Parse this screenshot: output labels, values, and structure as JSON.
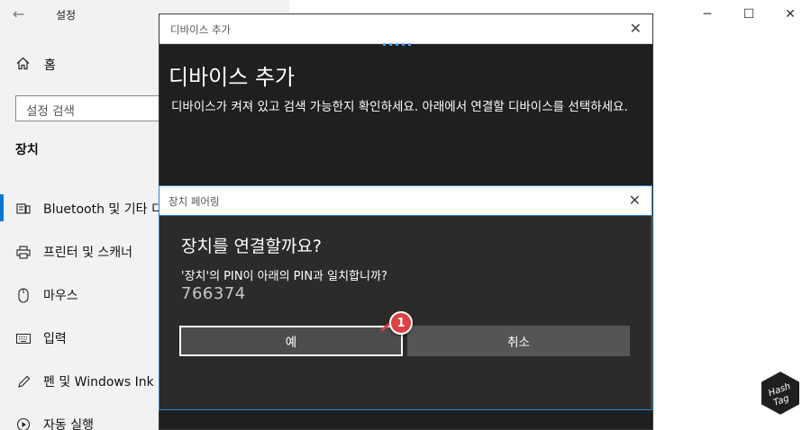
{
  "settings": {
    "app_title": "설정",
    "home_label": "홈",
    "search_placeholder": "설정 검색",
    "section_title": "장치",
    "nav_items": [
      {
        "label": "Bluetooth 및 기타 디",
        "icon": "keyboard-speaker-icon",
        "active": true
      },
      {
        "label": "프린터 및 스캐너",
        "icon": "printer-icon",
        "active": false
      },
      {
        "label": "마우스",
        "icon": "mouse-icon",
        "active": false
      },
      {
        "label": "입력",
        "icon": "keyboard-icon",
        "active": false
      },
      {
        "label": "펜 및 Windows Ink",
        "icon": "pen-icon",
        "active": false
      },
      {
        "label": "자동 실행",
        "icon": "autoplay-icon",
        "active": false
      }
    ]
  },
  "add_device": {
    "window_title": "디바이스 추가",
    "heading": "디바이스 추가",
    "description": "디바이스가 켜져 있고 검색 가능한지 확인하세요. 아래에서 연결할 디바이스를 선택하세요."
  },
  "pairing": {
    "window_title": "장치 페어링",
    "heading": "장치를 연결할까요?",
    "question": "'장치'의 PIN이 아래의 PIN과 일치합니까?",
    "pin": "766374",
    "yes_label": "예",
    "cancel_label": "취소"
  },
  "annotation": {
    "step_number": "1",
    "color": "#e04040"
  },
  "watermark": {
    "text_line1": "Hash",
    "text_line2": "Tag"
  },
  "colors": {
    "accent": "#0078d7",
    "dialog_bg": "#1f1f1f",
    "pairing_border": "#1e88d8"
  }
}
